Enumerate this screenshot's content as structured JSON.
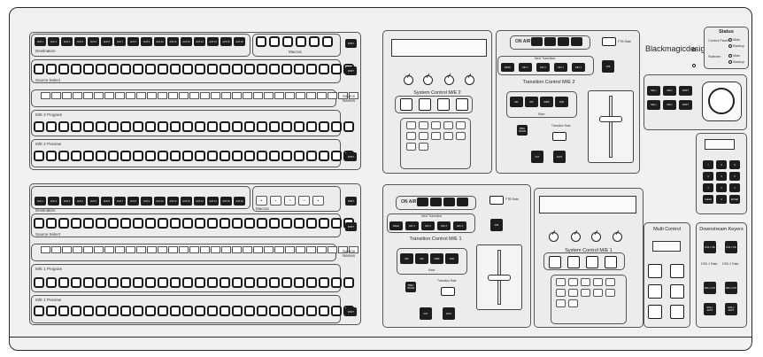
{
  "brand": "Blackmagicdesign",
  "status": {
    "title": "Status",
    "control_panel_label": "Control Panel",
    "switcher_label": "Switcher",
    "main_label": "Main",
    "backup_label": "Backup"
  },
  "me2": {
    "destination_label": "Destination",
    "source_select_label": "Source Select",
    "source_names_label": "Source Names",
    "program_label": "M/E 2 Program",
    "preview_label": "M/E 2 Preview",
    "macros_label": "Macros",
    "aux_buttons": [
      "AUX 1",
      "AUX 2",
      "AUX 3",
      "AUX 4",
      "AUX 5",
      "AUX 6",
      "AUX 7",
      "AUX 8",
      "AUX 9",
      "AUX 10",
      "AUX 11",
      "AUX 12",
      "AUX 13",
      "AUX 14",
      "AUX 15",
      "AUX 16"
    ]
  },
  "me1": {
    "destination_label": "Destination",
    "source_select_label": "Source Select",
    "source_names_label": "Source Names",
    "program_label": "M/E 1 Program",
    "preview_label": "M/E 1 Preview",
    "macros_label": "Macros",
    "aux_buttons": [
      "AUX 1",
      "AUX 2",
      "AUX 3",
      "AUX 4",
      "AUX 5",
      "AUX 6",
      "AUX 7",
      "AUX 8",
      "AUX 9",
      "AUX 10",
      "AUX 11",
      "AUX 12",
      "AUX 13",
      "AUX 14",
      "AUX 15",
      "AUX 16"
    ]
  },
  "system_control_me2": {
    "title": "System Control M/E 2"
  },
  "system_control_me1": {
    "title": "System Control M/E 1"
  },
  "transition_me2": {
    "title": "Transition Control M/E 2",
    "on_air": "ON AIR",
    "next_transition": "Next Transition",
    "ftb_rate": "FTB Rate",
    "ftb": "FTB",
    "rate": "Rate",
    "transition_rate": "Transition Rate",
    "cut": "CUT",
    "auto": "AUTO",
    "keys": [
      "BKGD",
      "KEY 1",
      "KEY 2",
      "KEY 3",
      "KEY 4"
    ],
    "types": [
      "MIX",
      "DIP",
      "WIPE",
      "DVE"
    ],
    "preview_trans": "PREV TRANS"
  },
  "transition_me1": {
    "title": "Transition Control M/E 1",
    "on_air": "ON AIR",
    "next_transition": "Next Transition",
    "ftb_rate": "FTB Rate",
    "ftb": "FTB",
    "rate": "Rate",
    "transition_rate": "Transition Rate",
    "cut": "CUT",
    "auto": "AUTO",
    "keys": [
      "BKGD",
      "KEY 1",
      "KEY 2",
      "KEY 3",
      "KEY 4"
    ],
    "types": [
      "MIX",
      "DIP",
      "WIPE",
      "DVE"
    ],
    "preview_trans": "PREV TRANS"
  },
  "multi_control": {
    "title": "Multi Control"
  },
  "downstream_keyers": {
    "title": "Downstream Keyers",
    "dsk1_rate": "DSK 1 Rate",
    "dsk2_rate": "DSK 2 Rate",
    "buttons": [
      "DSK 1 TIE",
      "DSK 2 TIE",
      "DSK 1 CUT",
      "DSK 2 CUT",
      "DSK 1 AUTO",
      "DSK 2 AUTO"
    ]
  },
  "joystick_buttons": [
    "M/E 1",
    "M/E 2",
    "SHIFT",
    "M/E 1",
    "M/E 2",
    "SHIFT"
  ],
  "keypad": [
    "7",
    "8",
    "9",
    "4",
    "5",
    "6",
    "1",
    "2",
    "3",
    "CLEAR",
    "0",
    "ENTER"
  ]
}
